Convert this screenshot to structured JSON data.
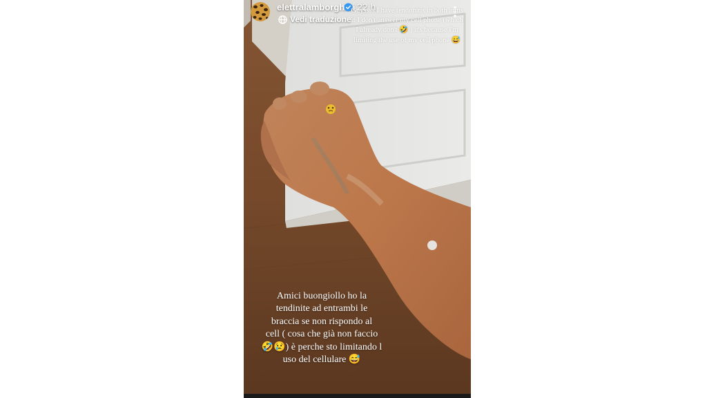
{
  "story": {
    "username": "elettralamborghini",
    "time": "22 h",
    "translate_label": "Vedi traduzione",
    "caption_top": "Guyssss I have tendonitis in both arms if I don't answer my cell phone (which I already don't 🤣 ) it's because I'm limiting the use of my cell phone 😅",
    "caption_bottom": "Amici buongiollo ho la\ntendinite ad entrambi le\nbraccia se non rispondo al\ncell ( cosa che già non faccio\n🤣😢) è perche sto limitando l\nuso del cellulare 😅",
    "icons": {
      "verified": "verified-badge-icon",
      "menu": "more-options-icon",
      "translate": "translate-icon",
      "avatar": "leopard-avatar"
    },
    "colors": {
      "verified": "#3897f0",
      "text": "#ffffff",
      "page_bg": "#ffffff"
    }
  }
}
